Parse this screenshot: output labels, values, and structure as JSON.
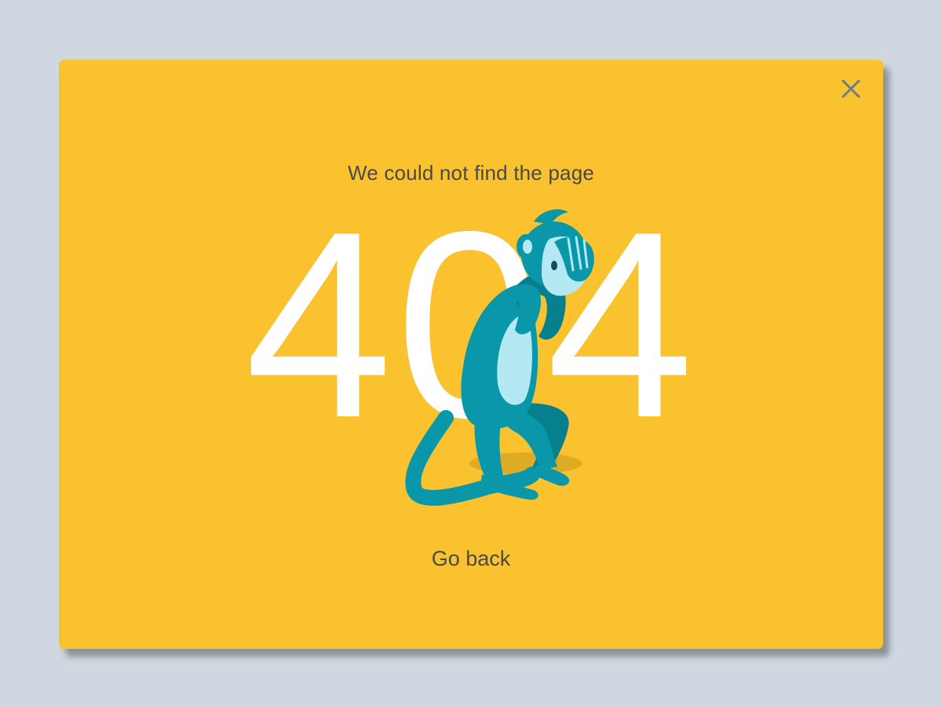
{
  "dialog": {
    "message": "We could not find the page",
    "error_code": "404",
    "go_back_label": "Go back",
    "close_icon": "close-icon",
    "illustration": "see-no-evil-monkey-illustration"
  },
  "colors": {
    "page_background": "#CFD8E0",
    "card_background": "#F9C22E",
    "text": "#4A4A48",
    "code_text": "#FFFFFF",
    "monkey_primary": "#0A97AA",
    "monkey_dark": "#06808F",
    "monkey_light": "#B4E8F2",
    "close_icon": "#6E7B86"
  }
}
